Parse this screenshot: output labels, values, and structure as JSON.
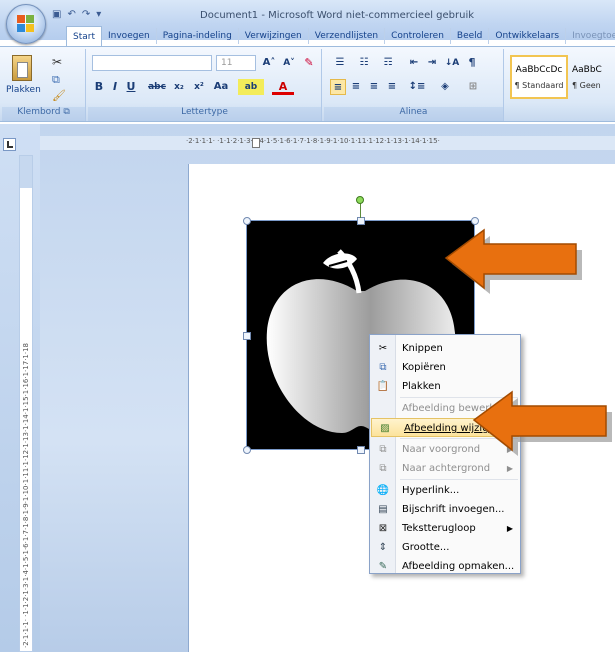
{
  "window": {
    "title": "Document1 - Microsoft Word niet-commercieel gebruik"
  },
  "tabs": [
    "Start",
    "Invoegen",
    "Pagina-indeling",
    "Verwijzingen",
    "Verzendlijsten",
    "Controleren",
    "Beeld",
    "Ontwikkelaars",
    "Invoegtoe"
  ],
  "clipboard": {
    "paste_label": "Plakken",
    "group_label": "Klembord"
  },
  "font": {
    "size_value": "11",
    "group_label": "Lettertype"
  },
  "paragraph": {
    "group_label": "Alinea"
  },
  "styles": {
    "style1_preview": "AaBbCcDc",
    "style1_name": "¶ Standaard",
    "style2_preview": "AaBbC",
    "style2_name": "¶ Geen"
  },
  "ruler": {
    "h_marks": "·2·1·1·1·  ·1·1·2·1·3·1·4·1·5·1·6·1·7·1·8·1·9·1·10·1·11·1·12·1·13·1·14·1·15·",
    "v_marks": "·2·1·1·1· ·1·1·2·1·3·1·4·1·5·1·6·1·7·1·8·1·9·1·10·1·11·1·12·1·13·1·14·1·15·1·16·1·17·1·18"
  },
  "context_menu": {
    "items": [
      {
        "label": "Knippen",
        "icon": "scissors-icon",
        "enabled": true
      },
      {
        "label": "Kopiëren",
        "icon": "copy-icon",
        "enabled": true
      },
      {
        "label": "Plakken",
        "icon": "paste-icon",
        "enabled": true
      },
      {
        "label": "Afbeelding bewerken",
        "icon": "",
        "enabled": false
      },
      {
        "label": "Afbeelding wijzigen...",
        "icon": "change-picture-icon",
        "enabled": true,
        "highlighted": true
      },
      {
        "label": "Naar voorgrond",
        "icon": "bring-forward-icon",
        "enabled": false
      },
      {
        "label": "Naar achtergrond",
        "icon": "send-backward-icon",
        "enabled": false
      },
      {
        "label": "Hyperlink...",
        "icon": "hyperlink-icon",
        "enabled": true
      },
      {
        "label": "Bijschrift invoegen...",
        "icon": "caption-icon",
        "enabled": true
      },
      {
        "label": "Tekstterugloop",
        "icon": "text-wrap-icon",
        "enabled": true
      },
      {
        "label": "Grootte...",
        "icon": "size-icon",
        "enabled": true
      },
      {
        "label": "Afbeelding opmaken...",
        "icon": "format-picture-icon",
        "enabled": true
      }
    ]
  },
  "colors": {
    "accent_arrow": "#e8700f",
    "selection_highlight": "#fce39c"
  }
}
